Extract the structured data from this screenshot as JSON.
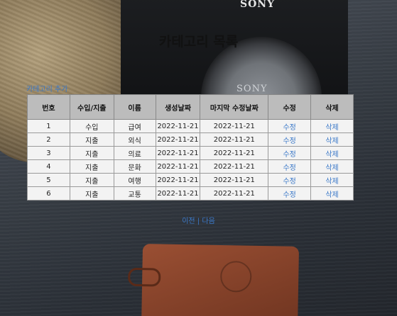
{
  "background": {
    "camera_brand": "SONY",
    "lens_brand": "SONY"
  },
  "page": {
    "title": "카테고리 목록",
    "add_link": "카테고리 추가"
  },
  "table": {
    "headers": [
      "번호",
      "수입/지출",
      "이름",
      "생성날짜",
      "마지막 수정날짜",
      "수정",
      "삭제"
    ],
    "rows": [
      {
        "no": "1",
        "type": "수입",
        "name": "급여",
        "created": "2022-11-21",
        "modified": "2022-11-21",
        "edit": "수정",
        "delete": "삭제"
      },
      {
        "no": "2",
        "type": "지출",
        "name": "외식",
        "created": "2022-11-21",
        "modified": "2022-11-21",
        "edit": "수정",
        "delete": "삭제"
      },
      {
        "no": "3",
        "type": "지출",
        "name": "의료",
        "created": "2022-11-21",
        "modified": "2022-11-21",
        "edit": "수정",
        "delete": "삭제"
      },
      {
        "no": "4",
        "type": "지출",
        "name": "문화",
        "created": "2022-11-21",
        "modified": "2022-11-21",
        "edit": "수정",
        "delete": "삭제"
      },
      {
        "no": "5",
        "type": "지출",
        "name": "여행",
        "created": "2022-11-21",
        "modified": "2022-11-21",
        "edit": "수정",
        "delete": "삭제"
      },
      {
        "no": "6",
        "type": "지출",
        "name": "교통",
        "created": "2022-11-21",
        "modified": "2022-11-21",
        "edit": "수정",
        "delete": "삭제"
      }
    ]
  },
  "pagination": {
    "prev": "이전",
    "separator": "|",
    "next": "다음"
  },
  "colors": {
    "link": "#3a78c8",
    "header_bg": "#bcbcbc",
    "table_bg": "#f3f3f3"
  }
}
